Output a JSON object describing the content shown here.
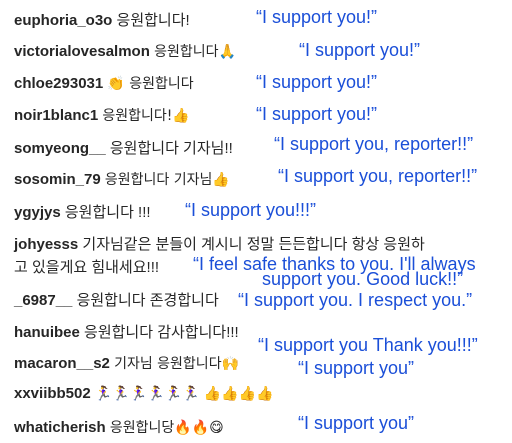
{
  "comments": [
    {
      "user": "euphoria_o3o",
      "text": "응원합니다!",
      "translation": "“I support you!”"
    },
    {
      "user": "victorialovesalmon",
      "text": "응원합니다🙏",
      "translation": "“I support you!”"
    },
    {
      "user": "chloe293031",
      "text": "👏 응원합니다",
      "translation": "“I support you!”"
    },
    {
      "user": "noir1blanc1",
      "text": "응원합니다!👍",
      "translation": "“I support you!”"
    },
    {
      "user": "somyeong__",
      "text": "응원합니다 기자님!!",
      "translation": "“I support you, reporter!!”"
    },
    {
      "user": "sosomin_79",
      "text": "응원합니다 기자님👍",
      "translation": "“I support you, reporter!!”"
    },
    {
      "user": "ygyjys",
      "text": "응원합니다 !!!",
      "translation": "“I support you!!!”"
    },
    {
      "user": "johyesss",
      "text": "기자님같은 분들이 계시니 정말 든든합니다 항상 응원하",
      "text2": "고 있을게요 힘내세요!!!",
      "translation": "“I feel safe thanks to you. I'll always",
      "translation2": "support you. Good luck!!”"
    },
    {
      "user": "_6987__",
      "text": "응원합니다 존경합니다",
      "translation": "“I support you. I respect you.”"
    },
    {
      "user": "hanuibee",
      "text": "응원합니다 감사합니다!!!",
      "translation": "“I support you Thank you!!!”"
    },
    {
      "user": "macaron__s2",
      "text": "기자님 응원합니다🙌",
      "translation": "“I support you”"
    },
    {
      "user": "xxviibb502",
      "text": "🏃‍♀️🏃‍♀️🏃‍♀️🏃‍♀️🏃‍♀️🏃‍♀️ 👍👍👍👍",
      "translation": ""
    },
    {
      "user": "whaticherish",
      "text": "응원합니당🔥🔥😋",
      "translation": "“I support you”"
    }
  ]
}
